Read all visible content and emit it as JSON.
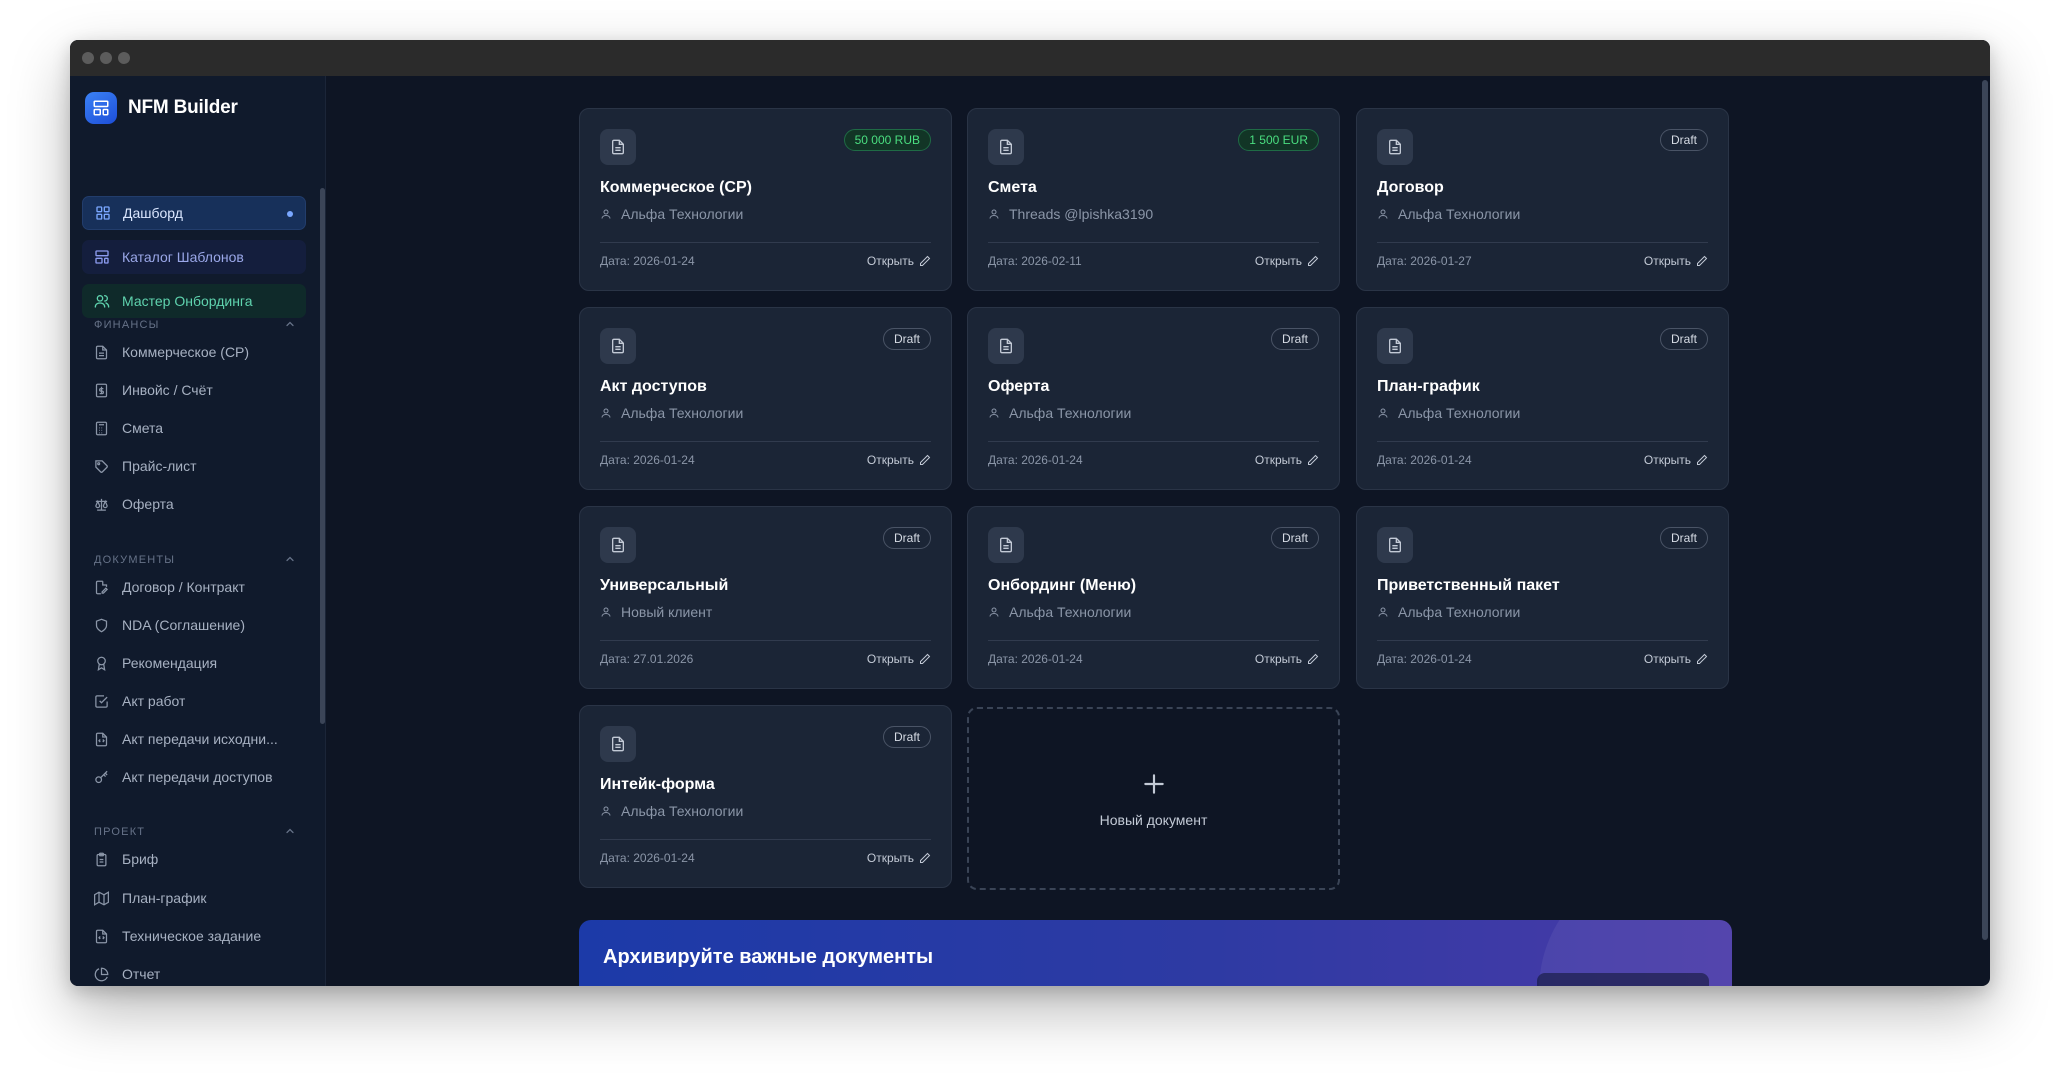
{
  "app": {
    "name": "NFM Builder"
  },
  "sidebar": {
    "primary": [
      {
        "label": "Дашборд",
        "icon": "layout-grid-icon",
        "active": true
      },
      {
        "label": "Каталог Шаблонов",
        "icon": "layout-template-icon"
      },
      {
        "label": "Мастер Онбординга",
        "icon": "users-icon"
      }
    ],
    "sections": [
      {
        "title": "ФИНАНСЫ",
        "items": [
          {
            "label": "Коммерческое (СР)",
            "icon": "file-text-icon"
          },
          {
            "label": "Инвойс / Счёт",
            "icon": "receipt-icon"
          },
          {
            "label": "Смета",
            "icon": "calculator-icon"
          },
          {
            "label": "Прайс-лист",
            "icon": "tag-icon"
          },
          {
            "label": "Оферта",
            "icon": "scale-icon"
          }
        ]
      },
      {
        "title": "ДОКУМЕНТЫ",
        "items": [
          {
            "label": "Договор / Контракт",
            "icon": "file-signature-icon"
          },
          {
            "label": "NDA (Соглашение)",
            "icon": "shield-icon"
          },
          {
            "label": "Рекомендация",
            "icon": "award-icon"
          },
          {
            "label": "Акт работ",
            "icon": "check-square-icon"
          },
          {
            "label": "Акт передачи исходни...",
            "icon": "file-code-icon"
          },
          {
            "label": "Акт передачи доступов",
            "icon": "key-icon"
          }
        ]
      },
      {
        "title": "ПРОЕКТ",
        "items": [
          {
            "label": "Бриф",
            "icon": "clipboard-icon"
          },
          {
            "label": "План-график",
            "icon": "map-icon"
          },
          {
            "label": "Техническое задание",
            "icon": "file-code-icon"
          },
          {
            "label": "Отчет",
            "icon": "pie-chart-icon"
          }
        ]
      }
    ]
  },
  "cards": [
    {
      "title": "Коммерческое (СР)",
      "client": "Альфа Технологии",
      "date": "Дата: 2026-01-24",
      "badge": "50 000 RUB",
      "badge_type": "amount",
      "open": "Открыть"
    },
    {
      "title": "Смета",
      "client": "Threads @lpishka3190",
      "date": "Дата: 2026-02-11",
      "badge": "1 500 EUR",
      "badge_type": "amount",
      "open": "Открыть"
    },
    {
      "title": "Договор",
      "client": "Альфа Технологии",
      "date": "Дата: 2026-01-27",
      "badge": "Draft",
      "badge_type": "draft",
      "open": "Открыть"
    },
    {
      "title": "Акт доступов",
      "client": "Альфа Технологии",
      "date": "Дата: 2026-01-24",
      "badge": "Draft",
      "badge_type": "draft",
      "open": "Открыть"
    },
    {
      "title": "Оферта",
      "client": "Альфа Технологии",
      "date": "Дата: 2026-01-24",
      "badge": "Draft",
      "badge_type": "draft",
      "open": "Открыть"
    },
    {
      "title": "План-график",
      "client": "Альфа Технологии",
      "date": "Дата: 2026-01-24",
      "badge": "Draft",
      "badge_type": "draft",
      "open": "Открыть"
    },
    {
      "title": "Универсальный",
      "client": "Новый клиент",
      "date": "Дата: 27.01.2026",
      "badge": "Draft",
      "badge_type": "draft",
      "open": "Открыть"
    },
    {
      "title": "Онбординг (Меню)",
      "client": "Альфа Технологии",
      "date": "Дата: 2026-01-24",
      "badge": "Draft",
      "badge_type": "draft",
      "open": "Открыть"
    },
    {
      "title": "Приветственный пакет",
      "client": "Альфа Технологии",
      "date": "Дата: 2026-01-24",
      "badge": "Draft",
      "badge_type": "draft",
      "open": "Открыть"
    },
    {
      "title": "Интейк-форма",
      "client": "Альфа Технологии",
      "date": "Дата: 2026-01-24",
      "badge": "Draft",
      "badge_type": "draft",
      "open": "Открыть"
    }
  ],
  "new_document": {
    "label": "Новый документ"
  },
  "banner": {
    "title": "Архивируйте важные документы"
  },
  "colors": {
    "background": "#0e1524",
    "sidebar": "#101a2c",
    "card": "#1b2536",
    "accent": "#3b82f6",
    "success": "#4ade80"
  }
}
